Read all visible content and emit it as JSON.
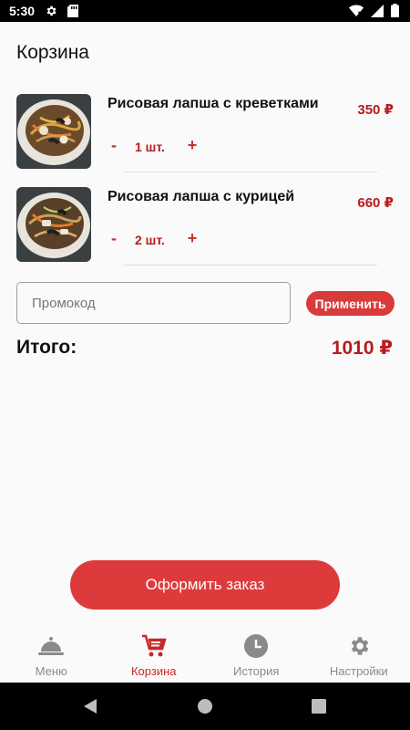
{
  "status_bar": {
    "time": "5:30"
  },
  "page": {
    "title": "Корзина"
  },
  "cart_items": [
    {
      "name": "Рисовая лапша с креветками",
      "price": "350 ₽",
      "quantity": "1 шт.",
      "minus": "-",
      "plus": "+"
    },
    {
      "name": "Рисовая лапша с курицей",
      "price": "660 ₽",
      "quantity": "2 шт.",
      "minus": "-",
      "plus": "+"
    }
  ],
  "promo": {
    "placeholder": "Промокод",
    "apply_label": "Применить"
  },
  "total": {
    "label": "Итого:",
    "value": "1010 ₽"
  },
  "checkout": {
    "label": "Оформить заказ"
  },
  "bottom_nav": [
    {
      "label": "Меню",
      "icon": "cloche-icon"
    },
    {
      "label": "Корзина",
      "icon": "cart-icon",
      "active": true
    },
    {
      "label": "История",
      "icon": "clock-icon"
    },
    {
      "label": "Настройки",
      "icon": "gear-icon"
    }
  ],
  "colors": {
    "accent": "#d93a3a",
    "price": "#b71c1c",
    "inactive": "#8a8a8a"
  }
}
